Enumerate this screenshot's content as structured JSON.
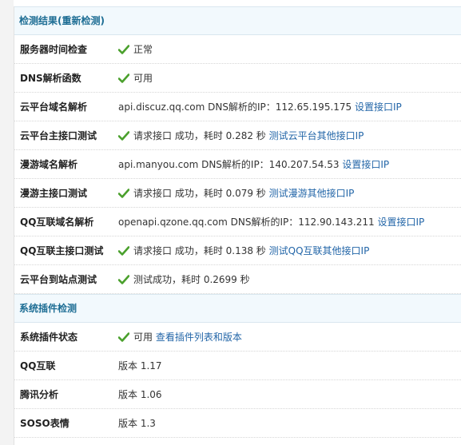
{
  "sections": [
    {
      "title": "检测结果(重新检测)",
      "rows": [
        {
          "label": "服务器时间检查",
          "check": true,
          "text": "正常",
          "link": ""
        },
        {
          "label": "DNS解析函数",
          "check": true,
          "text": "可用",
          "link": ""
        },
        {
          "label": "云平台域名解析",
          "check": false,
          "text": "api.discuz.qq.com DNS解析的IP：112.65.195.175",
          "link": "设置接口IP"
        },
        {
          "label": "云平台主接口测试",
          "check": true,
          "text": "请求接口 成功，耗时 0.282 秒",
          "link": "测试云平台其他接口IP"
        },
        {
          "label": "漫游域名解析",
          "check": false,
          "text": "api.manyou.com DNS解析的IP：140.207.54.53",
          "link": "设置接口IP"
        },
        {
          "label": "漫游主接口测试",
          "check": true,
          "text": "请求接口 成功，耗时 0.079 秒",
          "link": "测试漫游其他接口IP"
        },
        {
          "label": "QQ互联域名解析",
          "check": false,
          "text": "openapi.qzone.qq.com DNS解析的IP：112.90.143.211",
          "link": "设置接口IP"
        },
        {
          "label": "QQ互联主接口测试",
          "check": true,
          "text": "请求接口 成功，耗时 0.138 秒",
          "link": "测试QQ互联其他接口IP"
        },
        {
          "label": "云平台到站点测试",
          "check": true,
          "text": "测试成功，耗时 0.2699 秒",
          "link": ""
        }
      ]
    },
    {
      "title": "系统插件检测",
      "rows": [
        {
          "label": "系统插件状态",
          "check": true,
          "text": "可用",
          "link": "查看插件列表和版本"
        },
        {
          "label": "QQ互联",
          "check": false,
          "text": "版本 1.17",
          "link": ""
        },
        {
          "label": "腾讯分析",
          "check": false,
          "text": "版本 1.06",
          "link": ""
        },
        {
          "label": "SOSO表情",
          "check": false,
          "text": "版本 1.3",
          "link": ""
        }
      ]
    }
  ],
  "colors": {
    "section_bg": "#f2f9fd",
    "section_text": "#1d6d94",
    "link": "#2366a8",
    "check": "#4aa02c"
  }
}
